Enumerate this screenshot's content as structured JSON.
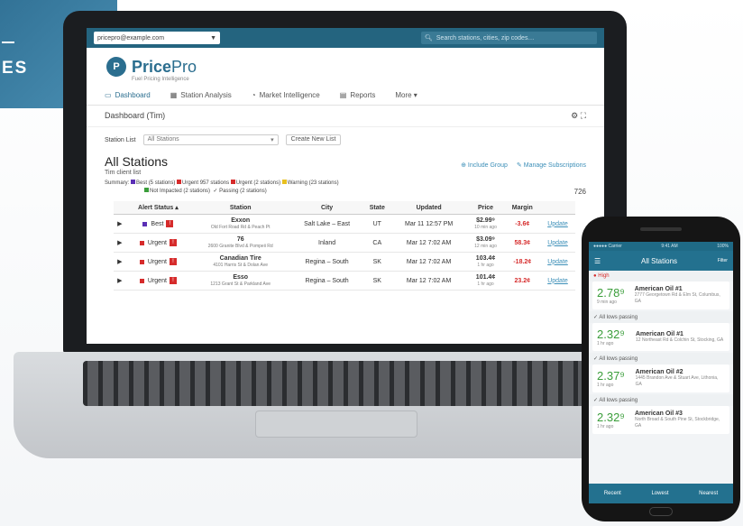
{
  "banner": {
    "rule": "—",
    "word": "ES"
  },
  "topbar": {
    "account_select": "pricepro@example.com",
    "search_placeholder": "Search stations, cities, zip codes…"
  },
  "brand": {
    "name_bold": "Price",
    "name_light": "Pro",
    "tagline": "Fuel Pricing Intelligence"
  },
  "nav": {
    "tabs": [
      {
        "icon": "monitor-icon",
        "label": "Dashboard"
      },
      {
        "icon": "grid-icon",
        "label": "Station Analysis"
      },
      {
        "icon": "gauge-icon",
        "label": "Market Intelligence"
      },
      {
        "icon": "chart-icon",
        "label": "Reports"
      },
      {
        "icon": "",
        "label": "More ▾"
      }
    ]
  },
  "subhead": {
    "label": "Dashboard (Tim)",
    "icons": "⚙ ⛶"
  },
  "filter": {
    "label": "Station List",
    "selected": "All Stations",
    "button": "Create New List"
  },
  "title": {
    "main": "All Stations",
    "sub": "Tim client list",
    "link1": "⊕ Include Group",
    "link2": "✎ Manage Subscriptions"
  },
  "summary": {
    "label": "Summary:",
    "item1": "Best (5 stations)",
    "item2": "Urgent 957 stations",
    "item3": "Urgent (2 stations)",
    "item4": "Warning (23 stations)",
    "item5": "Not Impacted (2 stations)",
    "item6": "✓ Passing (2 stations)",
    "count": "726"
  },
  "table": {
    "headers": [
      "Alert Status ▴",
      "Station",
      "City",
      "State",
      "Updated",
      "Price",
      "Margin",
      ""
    ],
    "rows": [
      {
        "alert": "Best",
        "station": "Exxon",
        "address": "Old Fort Road Rd & Peach Pt",
        "city": "Salt Lake – East",
        "state": "UT",
        "updated": "Mar 11 12:57 PM",
        "price": "$2.99⁹",
        "price_sub": "10 min ago",
        "margin": "-3.6¢",
        "link": "Update"
      },
      {
        "alert": "Urgent",
        "station": "76",
        "address": "2600 Granite Blvd & Pompeii Rd",
        "city": "Inland",
        "state": "CA",
        "updated": "Mar 12 7:02 AM",
        "price": "$3.09⁹",
        "price_sub": "12 min ago",
        "margin": "58.3¢",
        "link": "Update"
      },
      {
        "alert": "Urgent",
        "station": "Canadian Tire",
        "address": "4101 Harris St & Dolan Ave",
        "city": "Regina – South",
        "state": "SK",
        "updated": "Mar 12 7:02 AM",
        "price": "103.4¢",
        "price_sub": "1 hr ago",
        "margin": "-18.2¢",
        "link": "Update"
      },
      {
        "alert": "Urgent",
        "station": "Esso",
        "address": "1213 Grant St & Parkland Ave",
        "city": "Regina – South",
        "state": "SK",
        "updated": "Mar 12 7:02 AM",
        "price": "101.4¢",
        "price_sub": "1 hr ago",
        "margin": "23.2¢",
        "link": "Update"
      }
    ]
  },
  "phone": {
    "status_left": "●●●●● Carrier",
    "status_mid": "9:41 AM",
    "status_right": "100%",
    "header_menu": "☰",
    "header_title": "All Stations",
    "header_right": "Filter",
    "sections": [
      {
        "label": "● High",
        "price": "2.78⁹",
        "price_sub": "9 min ago",
        "name": "American Oil #1",
        "addr": "2777 Georgetown Rd & Elm St, Columbus, GA"
      },
      {
        "label": "✓ All lows passing",
        "price": "2.32⁹",
        "price_sub": "1 hr ago",
        "name": "American Oil #1",
        "addr": "12 Northeast Rd & Colchin St, Stocking, GA"
      },
      {
        "label": "✓ All lows passing",
        "price": "2.37⁹",
        "price_sub": "1 hr ago",
        "name": "American Oil #2",
        "addr": "1445 Brandon Ave & Stuart Ave, Lithonia, GA"
      },
      {
        "label": "✓ All lows passing",
        "price": "2.32⁹",
        "price_sub": "1 hr ago",
        "name": "American Oil #3",
        "addr": "North Broad & South Pine St, Stockbridge, GA"
      }
    ],
    "footer": [
      "Recent",
      "Lowest",
      "Nearest"
    ]
  }
}
